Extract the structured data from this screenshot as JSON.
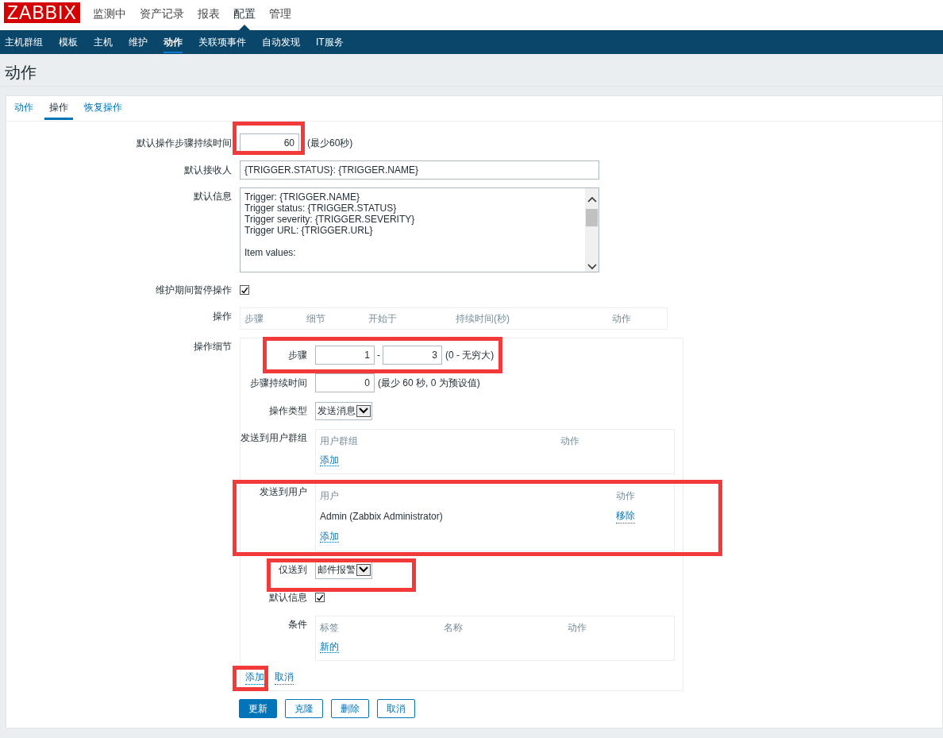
{
  "header": {
    "logo": "ZABBIX",
    "menu": [
      {
        "label": "监测中",
        "selected": false
      },
      {
        "label": "资产记录",
        "selected": false
      },
      {
        "label": "报表",
        "selected": false
      },
      {
        "label": "配置",
        "selected": true
      },
      {
        "label": "管理",
        "selected": false
      }
    ]
  },
  "submenu": [
    {
      "label": "主机群组",
      "selected": false
    },
    {
      "label": "模板",
      "selected": false
    },
    {
      "label": "主机",
      "selected": false
    },
    {
      "label": "维护",
      "selected": false
    },
    {
      "label": "动作",
      "selected": true
    },
    {
      "label": "关联项事件",
      "selected": false
    },
    {
      "label": "自动发现",
      "selected": false
    },
    {
      "label": "IT服务",
      "selected": false
    }
  ],
  "page_title": "动作",
  "tabs": [
    {
      "label": "动作",
      "selected": false
    },
    {
      "label": "操作",
      "selected": true
    },
    {
      "label": "恢复操作",
      "selected": false
    }
  ],
  "form": [
    {
      "kind": "number",
      "label": "默认操作步骤持续时间",
      "value": "60",
      "hint": "(最少60秒)"
    },
    {
      "kind": "text",
      "label": "默认接收人",
      "value": "{TRIGGER.STATUS}: {TRIGGER.NAME}"
    },
    {
      "kind": "textarea",
      "label": "默认信息",
      "paragraphs": [
        [
          "Trigger: {TRIGGER.NAME}",
          "Trigger status: {TRIGGER.STATUS}",
          "Trigger severity: {TRIGGER.SEVERITY}",
          "Trigger URL: {TRIGGER.URL}"
        ],
        [
          "Item values:"
        ]
      ]
    },
    {
      "kind": "checkbox",
      "label": "维护期间暂停操作",
      "checked": true
    },
    {
      "kind": "table",
      "label": "操作",
      "columns": [
        "步骤",
        "细节",
        "开始于",
        "持续时间(秒)",
        "动作"
      ]
    },
    {
      "kind": "details",
      "label": "操作细节",
      "rows": [
        {
          "kind": "range",
          "label": "步骤",
          "from": "1",
          "separator": "-",
          "to": "3",
          "hint": "(0 - 无穷大)"
        },
        {
          "kind": "number",
          "label": "步骤持续时间",
          "value": "0",
          "hint": "(最少 60 秒, 0 为预设值)"
        },
        {
          "kind": "select",
          "label": "操作类型",
          "value": "发送消息"
        },
        {
          "kind": "list",
          "label": "发送到用户群组",
          "columns": [
            "用户群组",
            "动作"
          ],
          "rows": [],
          "link": "添加"
        },
        {
          "kind": "list",
          "label": "发送到用户",
          "columns": [
            "用户",
            "动作"
          ],
          "rows": [
            {
              "name": "Admin (Zabbix Administrator)",
              "action": "移除"
            }
          ],
          "link": "添加"
        },
        {
          "kind": "select",
          "label": "仅送到",
          "value": "邮件报警"
        },
        {
          "kind": "checkbox",
          "label": "默认信息",
          "checked": true
        },
        {
          "kind": "list",
          "label": "条件",
          "columns": [
            "标签",
            "名称",
            "动作"
          ],
          "rows": [],
          "link": "新的"
        }
      ],
      "links": [
        "添加",
        "取消"
      ]
    }
  ],
  "buttons": [
    {
      "label": "更新",
      "primary": true
    },
    {
      "label": "克隆",
      "primary": false
    },
    {
      "label": "删除",
      "primary": false
    },
    {
      "label": "取消",
      "primary": false
    }
  ],
  "annotations": [
    {
      "kind": "highlight"
    },
    {
      "kind": "highlight"
    },
    {
      "kind": "highlight"
    },
    {
      "kind": "highlight"
    },
    {
      "kind": "highlight"
    }
  ]
}
